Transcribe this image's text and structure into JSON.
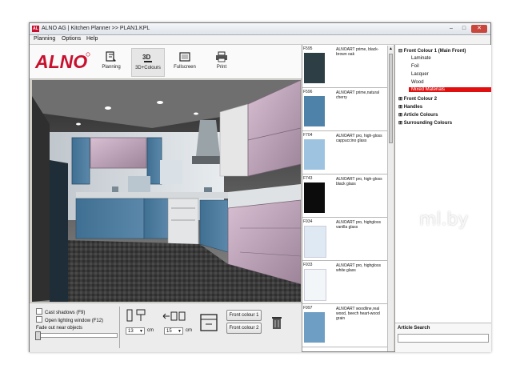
{
  "window": {
    "title": "ALNO AG | Kitchen Planner  >>  PLAN1.KPL",
    "icon_text": "AL",
    "controls": [
      "–",
      "□",
      "✕"
    ]
  },
  "menu": [
    "Planning",
    "Options",
    "Help"
  ],
  "brand": {
    "logo": "ALNO",
    "color": "#c8102e"
  },
  "toolbar": {
    "buttons": [
      {
        "label": "Planning",
        "icon": "planning-icon",
        "selected": false
      },
      {
        "label": "3D+Colours",
        "icon": "3d-colours-icon",
        "selected": true
      },
      {
        "label": "Fullscreen",
        "icon": "fullscreen-icon",
        "selected": false
      },
      {
        "label": "Print",
        "icon": "print-icon",
        "selected": false
      }
    ]
  },
  "view3d": {
    "description_icon": "kitchen-3d-render"
  },
  "bottom": {
    "checkboxes": [
      {
        "label": "Cast shadows (F9)",
        "checked": false
      },
      {
        "label": "Open lighting window (F12)",
        "checked": false
      }
    ],
    "fade_label": "Fade out near objects",
    "fade_value": 0,
    "dim1": {
      "value": "13",
      "unit": "cm"
    },
    "dim2": {
      "value": "15",
      "unit": "cm"
    },
    "front_colour_1": "Front colour 1",
    "front_colour_2": "Front colour 2"
  },
  "catalog": [
    {
      "code": "F595",
      "desc": "ALNOART prime, black-brown oak",
      "color": "#2d3f44"
    },
    {
      "code": "F596",
      "desc": "ALNOART prime,natural cherry",
      "color": "#4f82a8"
    },
    {
      "code": "F704",
      "desc": "ALNOART pro, high-gloss cappuccino glass",
      "color": "#9dc3e0"
    },
    {
      "code": "F743",
      "desc": "ALNOART pro, high-gloss black glass",
      "color": "#0c0c0c"
    },
    {
      "code": "F934",
      "desc": "ALNOART pro, highgloss vanilla glass",
      "color": "#dfe9f3"
    },
    {
      "code": "F933",
      "desc": "ALNOART pro, highgloss white glass",
      "color": "#f3f6f9"
    },
    {
      "code": "F997",
      "desc": "ALNOART woodline,real wood, beech heart-wood grain",
      "color": "#6e9ec4"
    }
  ],
  "tree": {
    "groups": [
      {
        "label": "Front Colour 1 (Main Front)",
        "expanded": true,
        "children": [
          "Laminate",
          "Foil",
          "Lacquer",
          "Wood",
          "Mixed Materials"
        ]
      },
      {
        "label": "Front Colour 2"
      },
      {
        "label": "Handles"
      },
      {
        "label": "Article Colours"
      },
      {
        "label": "Surrounding Colours"
      }
    ],
    "selected_child": "Mixed Materials",
    "highlight_color": "#e01010"
  },
  "search": {
    "label": "Article Search",
    "value": ""
  },
  "watermark": "ml.by"
}
